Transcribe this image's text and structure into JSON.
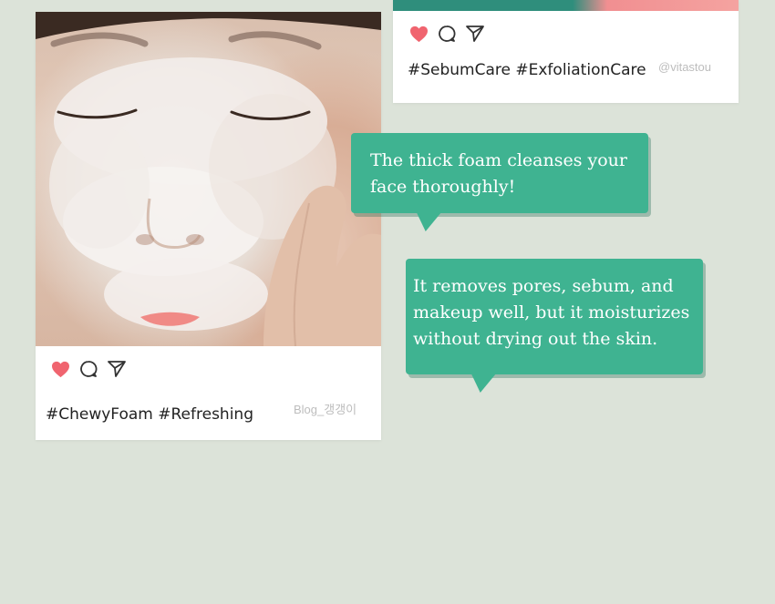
{
  "colors": {
    "background": "#dce3d9",
    "card": "#ffffff",
    "bubble": "#3fb391",
    "heart": "#f0646f",
    "credit_text": "#bdbdbd"
  },
  "card_top": {
    "icons": [
      "heart-icon",
      "comment-icon",
      "share-icon"
    ],
    "tags": "#SebumCare #ExfoliationCare",
    "credit": "@vitastou"
  },
  "card_left": {
    "photo": "woman-washing-face-with-foam",
    "icons": [
      "heart-icon",
      "comment-icon",
      "share-icon"
    ],
    "tags": "#ChewyFoam #Refreshing",
    "credit": "Blog_갱갱이"
  },
  "bubbles": [
    {
      "lines": [
        "The thick foam cleanses your",
        "face thoroughly!"
      ]
    },
    {
      "lines": [
        "It removes pores, sebum, and",
        "makeup well, but it moisturizes",
        "without drying out the skin."
      ]
    }
  ]
}
